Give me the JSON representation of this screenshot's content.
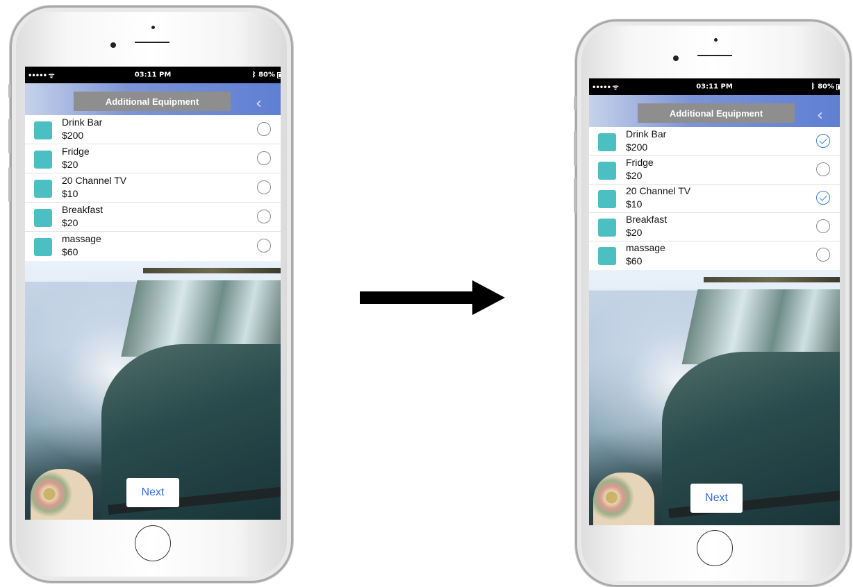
{
  "arrow": {
    "icon": "right-arrow-icon"
  },
  "screens": [
    {
      "state": "before",
      "status": {
        "signal": "••••• ᯤ",
        "time": "03:11 PM",
        "battery": "80%"
      },
      "nav": {
        "title": "Additional Equipment",
        "back_icon": "chevron-left-icon"
      },
      "items": [
        {
          "name": "Drink Bar",
          "price": "$200",
          "checked": false
        },
        {
          "name": "Fridge",
          "price": "$20",
          "checked": false
        },
        {
          "name": "20 Channel TV",
          "price": "$10",
          "checked": false
        },
        {
          "name": "Breakfast",
          "price": "$20",
          "checked": false
        },
        {
          "name": "massage",
          "price": "$60",
          "checked": false
        }
      ],
      "next_label": "Next"
    },
    {
      "state": "after",
      "status": {
        "signal": "••••• ᯤ",
        "time": "03:11 PM",
        "battery": "80%"
      },
      "nav": {
        "title": "Additional Equipment",
        "back_icon": "chevron-left-icon"
      },
      "items": [
        {
          "name": "Drink Bar",
          "price": "$200",
          "checked": true
        },
        {
          "name": "Fridge",
          "price": "$20",
          "checked": false
        },
        {
          "name": "20 Channel TV",
          "price": "$10",
          "checked": true
        },
        {
          "name": "Breakfast",
          "price": "$20",
          "checked": false
        },
        {
          "name": "massage",
          "price": "$60",
          "checked": false
        }
      ],
      "next_label": "Next"
    }
  ],
  "colors": {
    "accent": "#2e6ee0",
    "thumb": "#4bbfc2",
    "check": "#3b7ad9",
    "title_box": "#8e8e8e"
  }
}
